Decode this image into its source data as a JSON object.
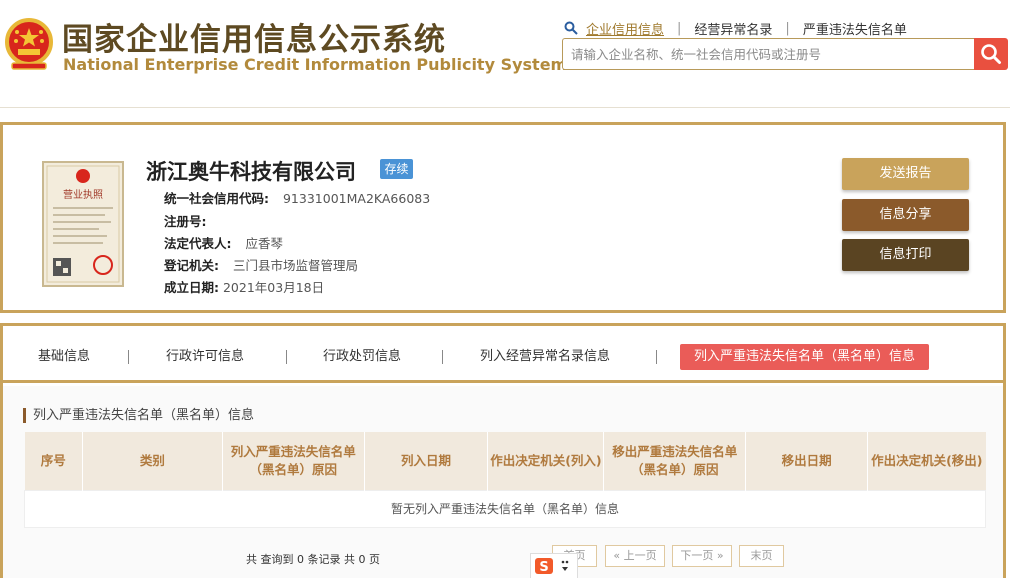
{
  "site": {
    "title_cn": "国家企业信用信息公示系统",
    "title_en": "National Enterprise Credit Information Publicity System"
  },
  "topnav": {
    "items": [
      "企业信用信息",
      "经营异常名录",
      "严重违法失信名单"
    ],
    "active_index": 0
  },
  "search": {
    "placeholder": "请输入企业名称、统一社会信用代码或注册号"
  },
  "company": {
    "name": "浙江奥牛科技有限公司",
    "status": "存续",
    "fields": [
      {
        "label": "统一社会信用代码:",
        "value": "91331001MA2KA66083"
      },
      {
        "label": "注册号:",
        "value": ""
      },
      {
        "label": "法定代表人:",
        "value": "应香琴"
      },
      {
        "label": "登记机关:",
        "value": "三门县市场监督管理局"
      },
      {
        "label": "成立日期:",
        "value": "2021年03月18日"
      }
    ],
    "license_label": "营业执照"
  },
  "actions": {
    "send_report": "发送报告",
    "share": "信息分享",
    "print": "信息打印"
  },
  "tabs": [
    "基础信息",
    "行政许可信息",
    "行政处罚信息",
    "列入经营异常名录信息",
    "列入严重违法失信名单（黑名单）信息"
  ],
  "active_tab": 4,
  "section": {
    "title": "列入严重违法失信名单（黑名单）信息",
    "columns": [
      "序号",
      "类别",
      "列入严重违法失信名单（黑名单）原因",
      "列入日期",
      "作出决定机关(列入)",
      "移出严重违法失信名单（黑名单）原因",
      "移出日期",
      "作出决定机关(移出)"
    ],
    "empty_text": "暂无列入严重违法失信名单（黑名单）信息"
  },
  "pagination": {
    "summary": "共 查询到 0 条记录 共 0 页",
    "first": "首页",
    "prev": "« 上一页",
    "next": "下一页 »",
    "last": "末页"
  },
  "colors": {
    "brand_brown": "#5e4a22",
    "gold": "#c9a35b",
    "active_tab": "#ea5c58",
    "status_blue": "#4a93d6",
    "search_red": "#e9503f",
    "btn_report": "#c9a35b",
    "btn_share": "#8b5a2b",
    "btn_print": "#5a4422"
  }
}
